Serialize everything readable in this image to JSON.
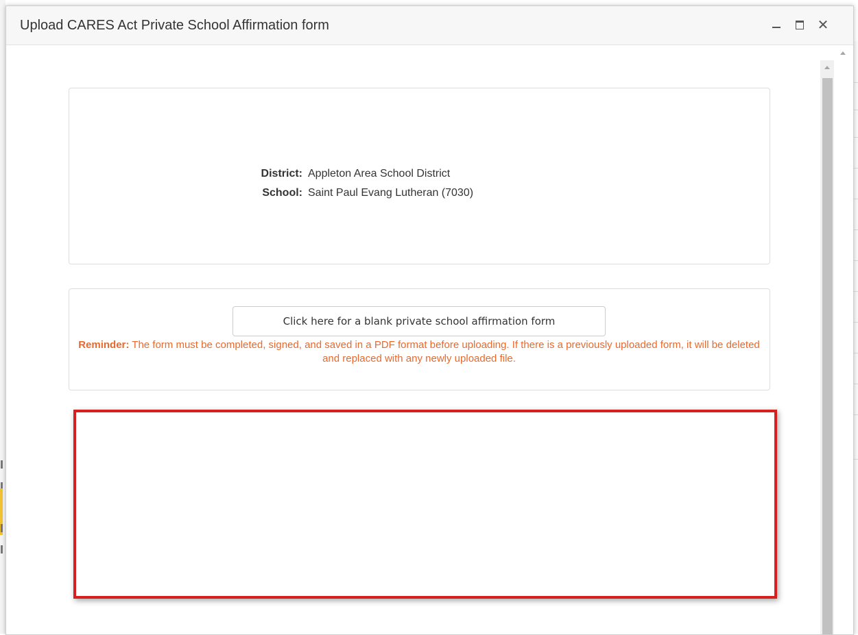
{
  "window": {
    "title": "Upload CARES Act Private School Affirmation form",
    "minimize_icon": "minimize-icon",
    "maximize_icon": "maximize-icon",
    "close_icon": "close-icon",
    "close_glyph": "✕"
  },
  "info": {
    "district_label": "District:",
    "district_value": "Appleton Area School District",
    "school_label": "School:",
    "school_value": "Saint Paul Evang Lutheran (7030)"
  },
  "form": {
    "blank_form_button": "Click here for a blank private school affirmation form",
    "reminder_label": "Reminder:",
    "reminder_text": " The form must be completed, signed, and saved in a PDF format before uploading. If there is a previously uploaded form, it will be deleted and replaced with any newly uploaded file."
  },
  "colors": {
    "reminder": "#e8692d",
    "highlight_border": "#d62020"
  }
}
